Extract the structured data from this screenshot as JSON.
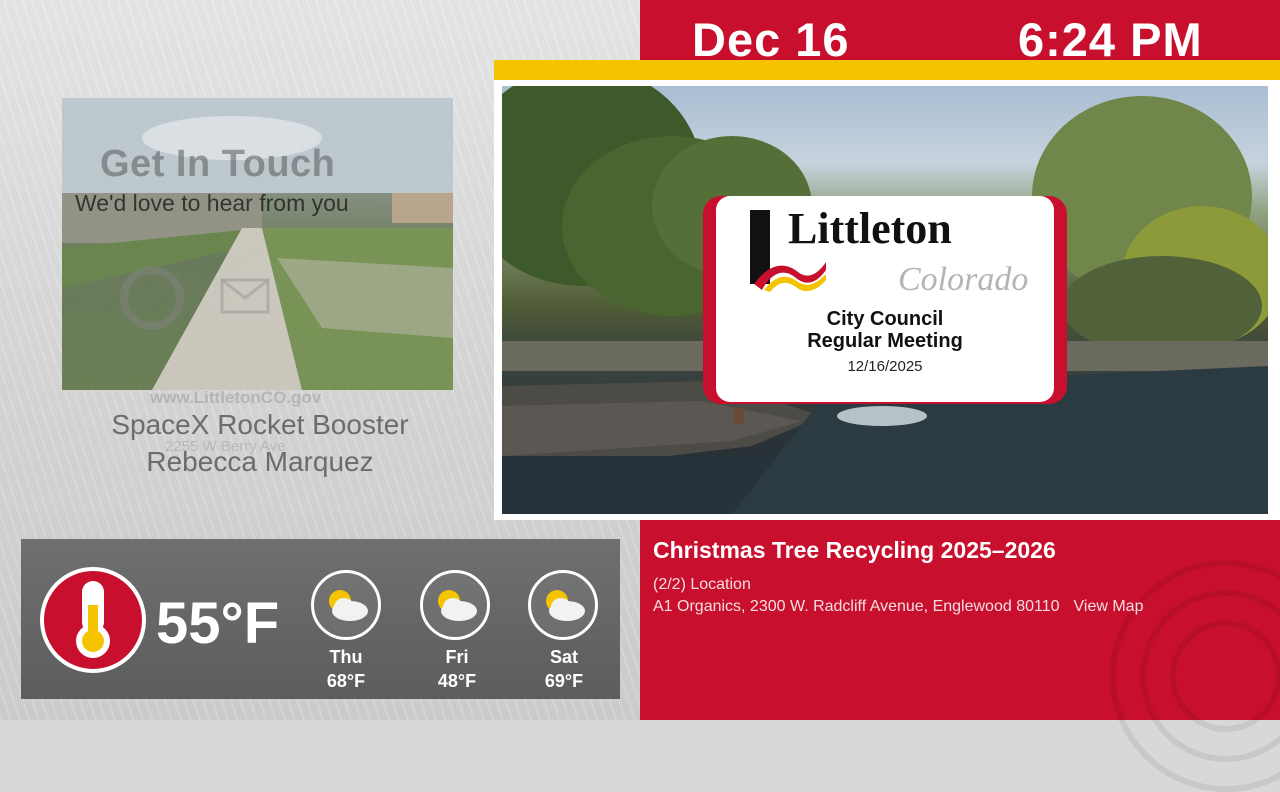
{
  "header": {
    "date": "Dec 16",
    "time": "6:24 PM"
  },
  "title_card": {
    "logo_name": "Littleton",
    "logo_subtitle": "Colorado",
    "meeting_title_line1": "City Council",
    "meeting_title_line2": "Regular Meeting",
    "meeting_date": "12/16/2025"
  },
  "contact_slide": {
    "heading": "Get In Touch",
    "subheading": "We'd love to hear from you",
    "website": "www.LittletonCO.gov",
    "address": "2255 W Berry Ave"
  },
  "credits": {
    "line1": "SpaceX Rocket Booster",
    "line2": "Rebecca Marquez"
  },
  "weather": {
    "current_temp": "55°F",
    "forecast": [
      {
        "day": "Thu",
        "temp": "68°F",
        "icon": "partly-cloudy-icon"
      },
      {
        "day": "Fri",
        "temp": "48°F",
        "icon": "partly-cloudy-icon"
      },
      {
        "day": "Sat",
        "temp": "69°F",
        "icon": "partly-cloudy-icon"
      }
    ]
  },
  "news": {
    "title": "Christmas Tree Recycling 2025–2026",
    "subtitle": "(2/2) Location",
    "detail": "A1 Organics, 2300 W. Radcliff Avenue, Englewood 80110",
    "link": "View Map"
  },
  "colors": {
    "brand_red": "#c8102e",
    "accent_yellow": "#f5c400",
    "panel_gray": "#5d5d5d"
  }
}
